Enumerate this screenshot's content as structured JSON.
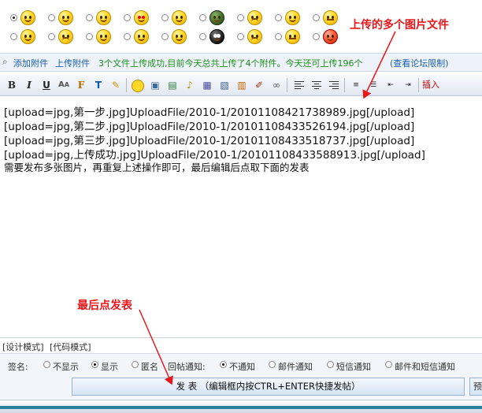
{
  "annotations": {
    "top_caption": "上传的多个图片文件",
    "bottom_caption": "最后点发表"
  },
  "upload_bar": {
    "add_attachment": "添加附件",
    "upload_attachment": "上传附件",
    "status": "3个文件上传成功,目前今天总共上传了4个附件。今天还可上传196个",
    "limit_link": "(查看论坛限制)"
  },
  "toolbar": {
    "bold": "B",
    "italic": "I",
    "underline": "U",
    "insert": "插入"
  },
  "editor": {
    "lines": [
      "[upload=jpg,第一步.jpg]UploadFile/2010-1/20101108421738989.jpg[/upload]",
      "[upload=jpg,第二步.jpg]UploadFile/2010-1/20101108433526194.jpg[/upload]",
      "[upload=jpg,第三步.jpg]UploadFile/2010-1/20101108433518737.jpg[/upload]",
      "[upload=jpg,上传成功.jpg]UploadFile/2010-1/20101108433588913.jpg[/upload]",
      "需要发布多张图片，再重复上述操作即可，最后编辑后点取下面的发表"
    ]
  },
  "modes": {
    "design": "[设计模式]",
    "code": "[代码模式]"
  },
  "options": {
    "signature_label": "签名:",
    "sig_hide": "不显示",
    "sig_show": "显示",
    "sig_anon": "匿名",
    "notify_label": "回帖通知:",
    "notify_none": "不通知",
    "notify_mail": "邮件通知",
    "notify_sms": "短信通知",
    "notify_both": "邮件和短信通知"
  },
  "submit": {
    "label": "发 表 （编辑框内按CTRL+ENTER快捷发帖）",
    "preview": "预"
  },
  "colors": {
    "caption_red": "#e8171a",
    "arrow_red": "#e8171a",
    "link_blue": "#1a5ea8",
    "status_green": "#1f8f1f"
  }
}
